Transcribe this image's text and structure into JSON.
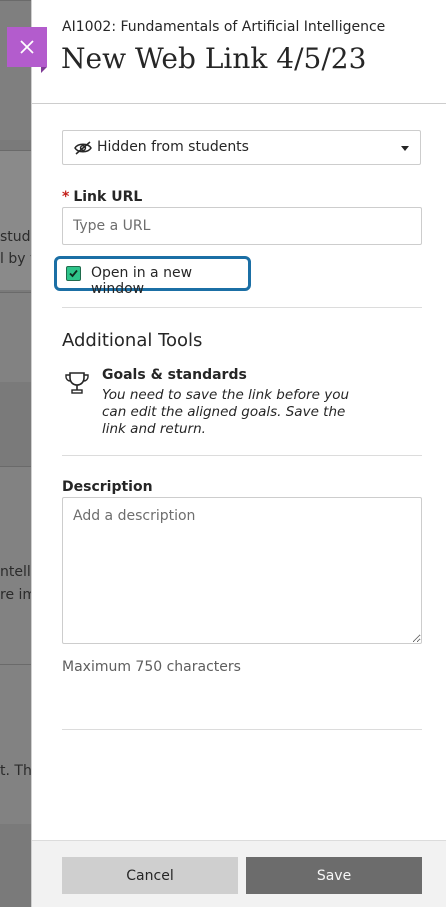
{
  "background": {
    "fragments": [
      "study",
      "l by y",
      "ntellig",
      "re im",
      "t. Th"
    ]
  },
  "header": {
    "course_title": "AI1002: Fundamentals of Artificial Intelligence",
    "page_title": "New Web Link 4/5/23",
    "close_icon": "close-icon",
    "accent_color": "#b35ccd"
  },
  "visibility": {
    "icon": "eye-slash-icon",
    "selected": "Hidden from students"
  },
  "link_url": {
    "required_marker": "*",
    "label": "Link URL",
    "placeholder": "Type a URL",
    "value": ""
  },
  "new_window": {
    "label": "Open in a new window",
    "checked": true,
    "check_color": "#2ec48a",
    "focus_color": "#1b6fa5"
  },
  "additional_tools": {
    "heading": "Additional Tools",
    "goals": {
      "icon": "trophy-icon",
      "title": "Goals & standards",
      "description": "You need to save the link before you can edit the aligned goals. Save the link and return."
    }
  },
  "description": {
    "label": "Description",
    "placeholder": "Add a description",
    "value": "",
    "limit_text": "Maximum 750 characters"
  },
  "footer": {
    "cancel_label": "Cancel",
    "save_label": "Save"
  }
}
